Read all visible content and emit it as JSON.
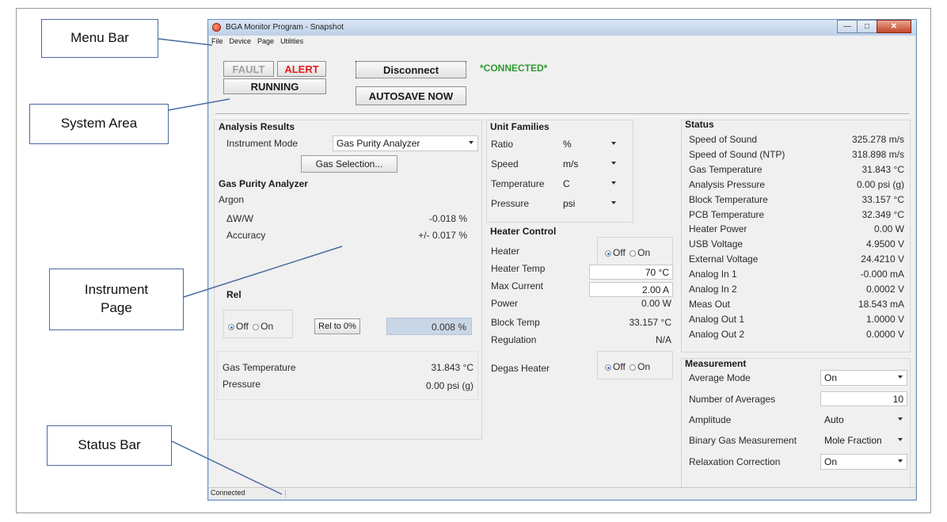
{
  "callouts": {
    "menu_bar": "Menu Bar",
    "system_area": "System Area",
    "instrument_page": "Instrument Page",
    "status_bar": "Status Bar"
  },
  "window": {
    "title": "BGA Monitor Program - Snapshot"
  },
  "menu": [
    "File",
    "Device",
    "Page",
    "Utilities"
  ],
  "system": {
    "fault": "FAULT",
    "alert": "ALERT",
    "running": "RUNNING",
    "disconnect": "Disconnect",
    "autosave": "AUTOSAVE NOW",
    "connected": "*CONNECTED*",
    "colors": {
      "fault_text": "#a0a0a0",
      "alert_text": "#e02020",
      "connected_text": "#2f9a2f"
    }
  },
  "analysis": {
    "title": "Analysis Results",
    "mode_label": "Instrument Mode",
    "mode_value": "Gas Purity Analyzer",
    "gas_selection": "Gas Selection...",
    "gpa_title": "Gas Purity Analyzer",
    "gas": "Argon",
    "dww_label": "ΔW/W",
    "dww_value": "-0.018 %",
    "accuracy_label": "Accuracy",
    "accuracy_value": "+/- 0.017 %",
    "rel_title": "Rel",
    "rel_off": "Off",
    "rel_on": "On",
    "rel_button": "Rel to 0%",
    "rel_value": "0.008 %",
    "gas_temp_label": "Gas Temperature",
    "gas_temp_value": "31.843 °C",
    "pressure_label": "Pressure",
    "pressure_value": "0.00 psi (g)"
  },
  "units": {
    "title": "Unit Families",
    "rows": [
      {
        "label": "Ratio",
        "value": "%"
      },
      {
        "label": "Speed",
        "value": "m/s"
      },
      {
        "label": "Temperature",
        "value": "C"
      },
      {
        "label": "Pressure",
        "value": "psi"
      }
    ]
  },
  "heater": {
    "title": "Heater Control",
    "heater_label": "Heater",
    "off": "Off",
    "on": "On",
    "temp_label": "Heater Temp",
    "temp_value": "70 °C",
    "max_current_label": "Max Current",
    "max_current_value": "2.00 A",
    "power_label": "Power",
    "power_value": "0.00 W",
    "block_temp_label": "Block Temp",
    "block_temp_value": "33.157 °C",
    "regulation_label": "Regulation",
    "regulation_value": "N/A",
    "degas_label": "Degas Heater"
  },
  "status": {
    "title": "Status",
    "rows": [
      {
        "label": "Speed of Sound",
        "value": "325.278 m/s"
      },
      {
        "label": "Speed of Sound (NTP)",
        "value": "318.898 m/s"
      },
      {
        "label": "Gas Temperature",
        "value": "31.843 °C"
      },
      {
        "label": "Analysis Pressure",
        "value": "0.00 psi (g)"
      },
      {
        "label": "Block Temperature",
        "value": "33.157 °C"
      },
      {
        "label": "PCB Temperature",
        "value": "32.349 °C"
      },
      {
        "label": "Heater Power",
        "value": "0.00 W"
      },
      {
        "label": "USB Voltage",
        "value": "4.9500 V"
      },
      {
        "label": "External Voltage",
        "value": "24.4210 V"
      },
      {
        "label": "Analog In 1",
        "value": "-0.000 mA"
      },
      {
        "label": "Analog In 2",
        "value": "0.0002 V"
      },
      {
        "label": "Meas Out",
        "value": "18.543 mA"
      },
      {
        "label": "Analog Out 1",
        "value": "1.0000 V"
      },
      {
        "label": "Analog Out 2",
        "value": "0.0000 V"
      }
    ]
  },
  "measurement": {
    "title": "Measurement",
    "average_mode_label": "Average Mode",
    "average_mode_value": "On",
    "num_avg_label": "Number of Averages",
    "num_avg_value": "10",
    "amplitude_label": "Amplitude",
    "amplitude_value": "Auto",
    "binary_label": "Binary Gas Measurement",
    "binary_value": "Mole Fraction",
    "relax_label": "Relaxation Correction",
    "relax_value": "On"
  },
  "statusbar": {
    "text": "Connected"
  }
}
